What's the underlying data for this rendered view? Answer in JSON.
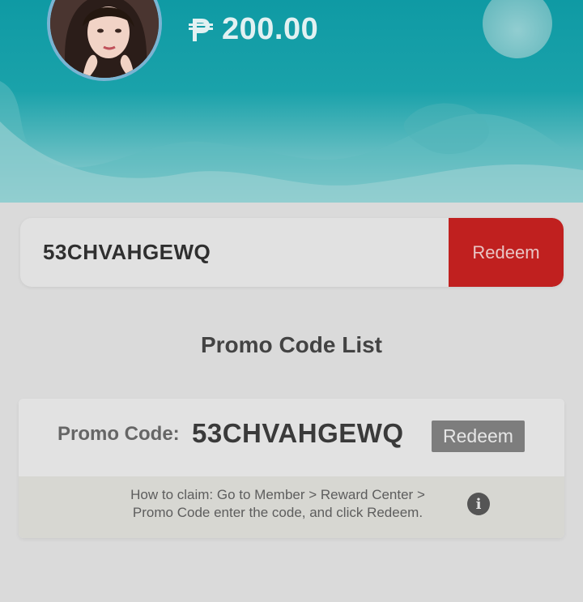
{
  "header": {
    "balance_amount": "200.00",
    "currency_icon": "peso-sign-icon",
    "avatar": "user-avatar"
  },
  "redeem_bar": {
    "code_value": "53CHVAHGEWQ",
    "redeem_label": "Redeem"
  },
  "promo_list": {
    "title": "Promo Code List",
    "items": [
      {
        "label": "Promo Code:",
        "code": "53CHVAHGEWQ",
        "redeem_label": "Redeem",
        "help_line1": "How to claim: Go to Member > Reward Center >",
        "help_line2": "Promo Code enter the code, and click Redeem.",
        "info_icon": "info-icon"
      }
    ]
  },
  "colors": {
    "header_teal": "#1aa2aa",
    "redeem_red": "#c0201f",
    "secondary_button_gray": "#7d7d7d"
  }
}
